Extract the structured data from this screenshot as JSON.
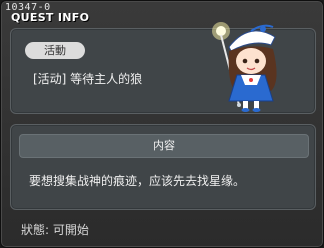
{
  "quest_id": "10347-0",
  "title": "QUEST INFO",
  "category_tag": "活動",
  "quest_name": "[活动] 等待主人的狼",
  "npc_icon": "npc-girl-with-lantern-staff-icon",
  "content_header": "内容",
  "content_text": "要想搜集战神的痕迹，应该先去找星缘。",
  "status_text": "狀態: 可開始"
}
